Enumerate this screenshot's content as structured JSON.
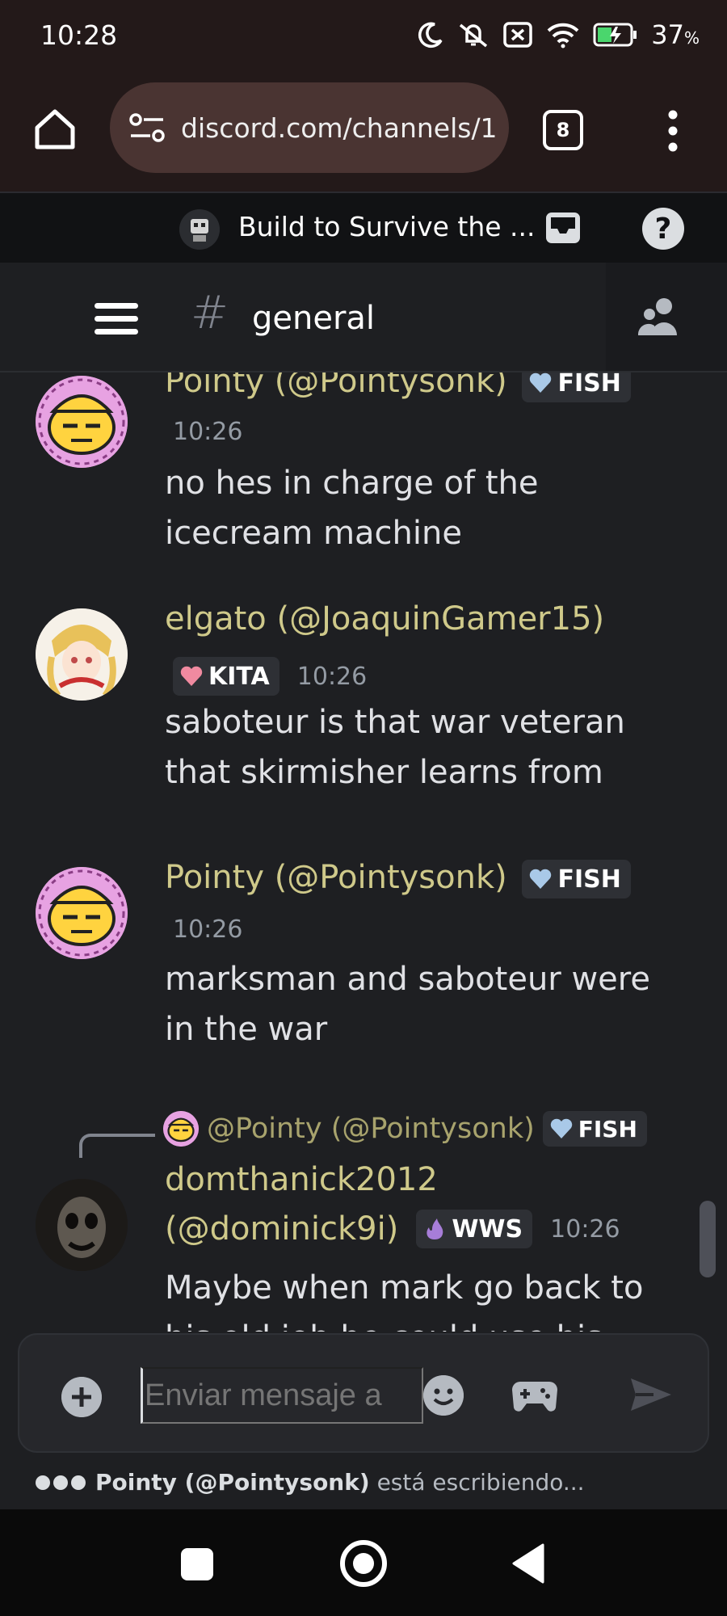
{
  "status": {
    "time": "10:28",
    "battery": "37",
    "battery_unit": "%"
  },
  "browser": {
    "url": "discord.com/channels/1",
    "tab_count": "8"
  },
  "server": {
    "name": "Build to Survive the ..."
  },
  "channel": {
    "hash": "#",
    "name": "general"
  },
  "messages": [
    {
      "author": "Pointy (@Pointysonk)",
      "tag": "FISH",
      "time": "10:26",
      "lines": [
        "no hes in charge of the",
        "icecream machine"
      ]
    },
    {
      "author": "elgato (@JoaquinGamer15)",
      "tag": "KITA",
      "time": "10:26",
      "lines": [
        "saboteur is that war veteran",
        "that skirmisher learns from"
      ]
    },
    {
      "author": "Pointy (@Pointysonk)",
      "tag": "FISH",
      "time": "10:26",
      "lines": [
        "marksman and saboteur were",
        "in the war"
      ]
    },
    {
      "reply_to": "@Pointy (@Pointysonk)",
      "reply_tag": "FISH",
      "author_line1": "domthanick2012",
      "author_line2": "(@dominick9i)",
      "tag": "WWS",
      "time": "10:26",
      "lines": [
        "Maybe when mark go back to",
        "his old job he could use his"
      ]
    }
  ],
  "composer": {
    "placeholder": "Enviar mensaje a"
  },
  "typing": {
    "user": "Pointy (@Pointysonk)",
    "suffix": "está escribiendo..."
  },
  "colors": {
    "username": "#cfc98a",
    "background": "#1e1f22",
    "fish_tag": "#a9c9e8",
    "kita_tag": "#f08aa0",
    "wws_tag": "#a77dd8"
  }
}
